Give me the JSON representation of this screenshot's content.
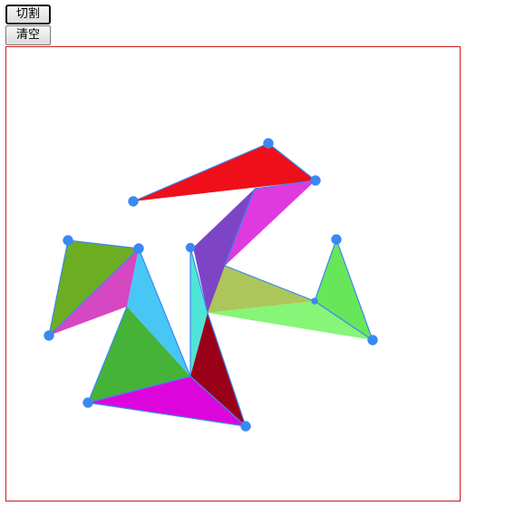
{
  "toolbar": {
    "cut_label": "切割",
    "clear_label": "清空"
  },
  "canvas": {
    "border_color": "#cc1b1b",
    "handle_color": "#3b88f2",
    "edge_color": "#3b88f2",
    "colors": {
      "red": "#ee0f1a",
      "magenta": "#df39df",
      "purple": "#7d45c6",
      "olive": "#adc65b",
      "green": "#68e65a",
      "lightgreen": "#86f578",
      "yellowgreen": "#6dad22",
      "pink": "#d647c2",
      "skyblue": "#48c7f7",
      "green2": "#45b338",
      "cyan": "#4fe4d8",
      "darkred": "#9b0019",
      "violet": "#dc06dc"
    }
  }
}
